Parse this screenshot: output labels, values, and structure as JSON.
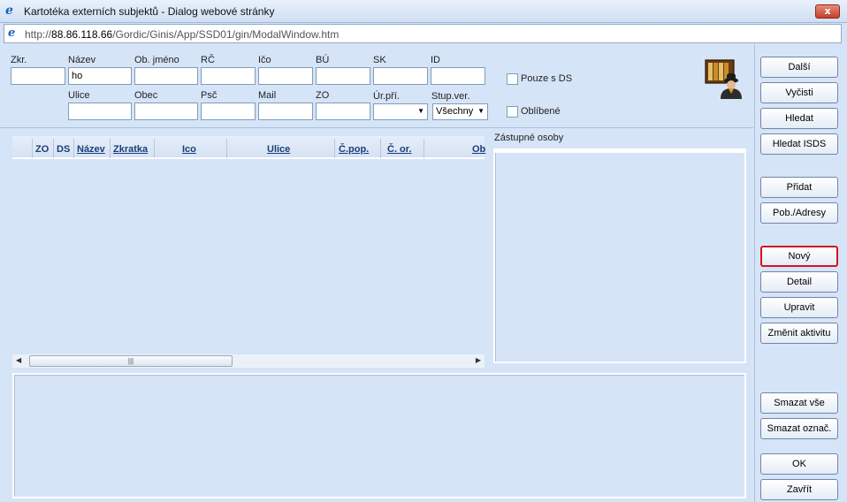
{
  "window": {
    "title": "Kartotéka externích subjektů - Dialog webové stránky",
    "close_glyph": "x"
  },
  "address": {
    "prefix": "http://",
    "host": "88.86.118.66",
    "path": "/Gordic/Ginis/App/SSD01/gin/ModalWindow.htm"
  },
  "filters": {
    "row1": {
      "zkr_label": "Zkr.",
      "nazev_label": "Název",
      "nazev_value": "ho",
      "objmeno_label": "Ob. jméno",
      "rc_label": "RČ",
      "ico_label": "Ičo",
      "bu_label": "BÚ",
      "sk_label": "SK",
      "id_label": "ID"
    },
    "row2": {
      "ulice_label": "Ulice",
      "obec_label": "Obec",
      "psc_label": "Psč",
      "mail_label": "Mail",
      "zo_label": "ZO",
      "urpri_label": "Úr.pří.",
      "urpri_value": "",
      "stupver_label": "Stup.ver.",
      "stupver_value": "Všechny"
    },
    "pouze_ds_label": "Pouze s DS",
    "pouze_ds_checked": false,
    "oblibene_label": "Oblíbené",
    "oblibene_checked": false
  },
  "grid": {
    "columns": [
      "ZO",
      "DS",
      "Název",
      "Zkratka",
      "Ico",
      "Ulice",
      "Č.pop.",
      "Č. or.",
      "Ob"
    ],
    "rows": []
  },
  "zastupne_osoby": {
    "label": "Zástupné osoby"
  },
  "buttons": {
    "dalsi": "Další",
    "vycisti": "Vyčisti",
    "hledat": "Hledat",
    "hledat_isds": "Hledat ISDS",
    "pridat": "Přidat",
    "pob_adresy": "Pob./Adresy",
    "novy": "Nový",
    "detail": "Detail",
    "upravit": "Upravit",
    "zmenit_aktivitu": "Změnit aktivitu",
    "smazat_vse": "Smazat vše",
    "smazat_oznac": "Smazat označ.",
    "ok": "OK",
    "zavrit": "Zavřít"
  },
  "colors": {
    "background": "#d6e4f8",
    "focus_border": "#d2151e",
    "header_text": "#1a3f7a"
  },
  "icons": {
    "window_icon": "ie-icon",
    "address_icon": "ie-icon",
    "archive_icon": "archive-person-icon"
  }
}
